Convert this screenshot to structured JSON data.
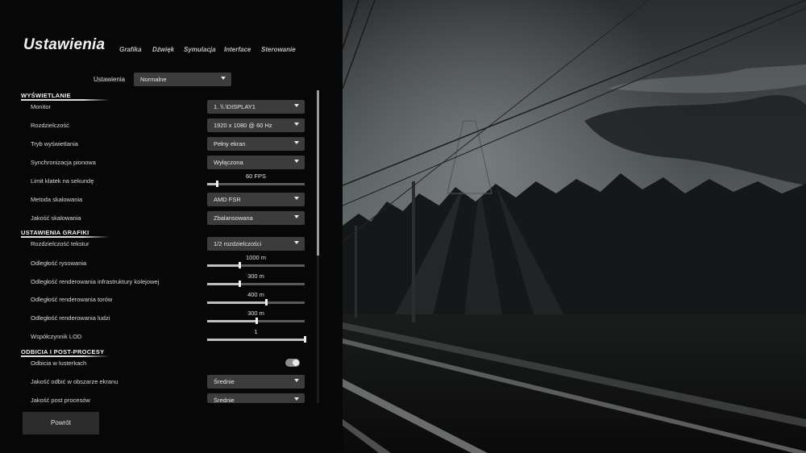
{
  "header": {
    "title": "Ustawienia",
    "tabs": [
      {
        "label": "Grafika"
      },
      {
        "label": "Dźwięk"
      },
      {
        "label": "Symulacja"
      },
      {
        "label": "Interface"
      },
      {
        "label": "Sterowanie"
      }
    ]
  },
  "preset": {
    "label": "Ustawienia",
    "value": "Normalne"
  },
  "sections": {
    "display": "WYŚWIETLANIE",
    "graphics": "USTAWIENIA GRAFIKI",
    "reflections": "ODBICIA I POST-PROCESY"
  },
  "display": {
    "monitor": {
      "label": "Monitor",
      "value": "1. \\\\.\\DISPLAY1"
    },
    "resolution": {
      "label": "Rozdzielczość",
      "value": "1920 x 1080 @ 60 Hz"
    },
    "display_mode": {
      "label": "Tryb wyświetlania",
      "value": "Pełny ekran"
    },
    "vsync": {
      "label": "Synchronizacja pionowa",
      "value": "Wyłączona"
    },
    "fps_limit": {
      "label": "Limit klatek na sekundę",
      "value": "60 FPS",
      "level": 0.1
    },
    "scaling_method": {
      "label": "Metoda skalowania",
      "value": "AMD FSR"
    },
    "scaling_quality": {
      "label": "Jakość skalowania",
      "value": "Zbalansowana"
    }
  },
  "graphics": {
    "texture_resolution": {
      "label": "Rozdzielczość tekstur",
      "value": "1/2 rozdzielczości"
    },
    "draw_distance": {
      "label": "Odległość rysowania",
      "value": "1000 m",
      "level": 0.33
    },
    "rail_infra_distance": {
      "label": "Odległość renderowania infrastruktury kolejowej",
      "value": "300 m",
      "level": 0.33
    },
    "track_distance": {
      "label": "Odległość renderowania torów",
      "value": "400 m",
      "level": 0.6
    },
    "people_distance": {
      "label": "Odległość renderowania ludzi",
      "value": "300 m",
      "level": 0.5
    },
    "lod_factor": {
      "label": "Współczynnik LOD",
      "value": "1",
      "level": 1.0
    }
  },
  "reflections": {
    "mirror_reflections": {
      "label": "Odbicia w lusterkach",
      "on": true
    },
    "ssr_quality": {
      "label": "Jakość odbić w obszarze ekranu",
      "value": "Średnie"
    },
    "post_quality": {
      "label": "Jakość post procesów",
      "value": "Średnie"
    }
  },
  "footer": {
    "back_label": "Powrót"
  },
  "colors": {
    "panel_bg": "#070707",
    "control_bg": "#3c3c3c",
    "accent": "#f0f0f0"
  }
}
